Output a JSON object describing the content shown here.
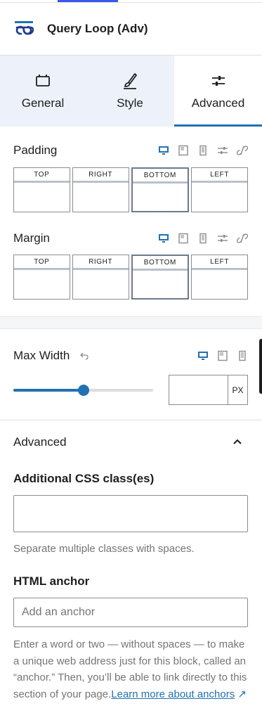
{
  "block": {
    "title": "Query Loop (Adv)",
    "icon": "query-loop-icon"
  },
  "tabs": [
    {
      "label": "General",
      "icon": "layout-icon"
    },
    {
      "label": "Style",
      "icon": "brush-icon"
    },
    {
      "label": "Advanced",
      "icon": "sliders-icon",
      "active": true
    }
  ],
  "padding": {
    "label": "Padding",
    "sides": [
      "TOP",
      "RIGHT",
      "BOTTOM",
      "LEFT"
    ]
  },
  "margin": {
    "label": "Margin",
    "sides": [
      "TOP",
      "RIGHT",
      "BOTTOM",
      "LEFT"
    ]
  },
  "max_width": {
    "label": "Max Width",
    "unit": "PX",
    "slider_fraction": 0.5,
    "value": ""
  },
  "advanced": {
    "section_title": "Advanced",
    "css_label": "Additional CSS class(es)",
    "css_value": "",
    "css_help": "Separate multiple classes with spaces.",
    "anchor_label": "HTML anchor",
    "anchor_placeholder": "Add an anchor",
    "anchor_help": "Enter a word or two — without spaces — to make a unique web address just for this block, called an “anchor.” Then, you’ll be able to link directly to this section of your page.",
    "anchor_link": "Learn more about anchors"
  },
  "colors": {
    "accent": "#2271b1",
    "tab_bg": "#edf1f9"
  }
}
